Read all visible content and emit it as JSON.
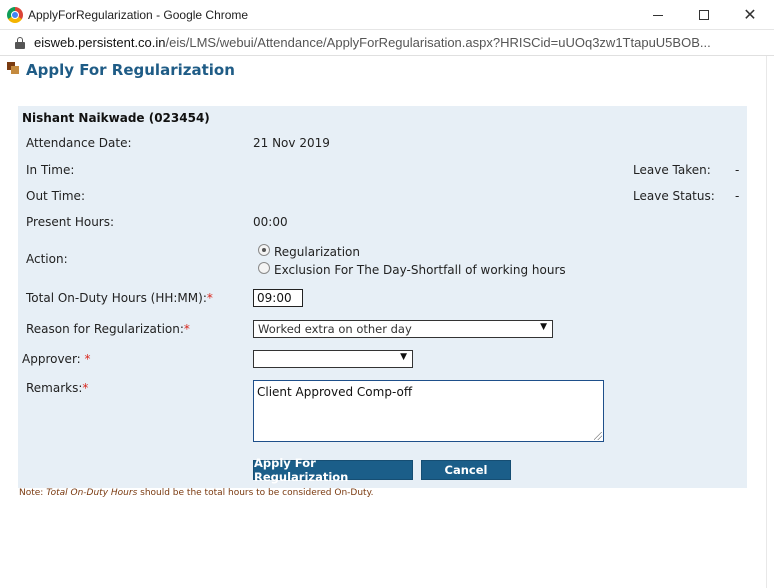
{
  "window": {
    "title": "ApplyForRegularization - Google Chrome",
    "url_prefix": "eisweb.persistent.co.in",
    "url_path": "/eis/LMS/webui/Attendance/ApplyForRegularisation.aspx?HRISCid=uUOq3zw1TtapuU5BOB..."
  },
  "page": {
    "title": "Apply For Regularization"
  },
  "employee": {
    "name": "Nishant Naikwade (023454)"
  },
  "fields": {
    "attendance_date_label": "Attendance Date:",
    "attendance_date_value": "21 Nov 2019",
    "in_time_label": "In Time:",
    "out_time_label": "Out Time:",
    "present_hours_label": "Present Hours:",
    "present_hours_value": "00:00",
    "leave_taken_label": "Leave Taken:",
    "leave_taken_value": "-",
    "leave_status_label": "Leave Status:",
    "leave_status_value": "-",
    "action_label": "Action:",
    "action_option_1": "Regularization",
    "action_option_2": "Exclusion For The Day-Shortfall of working hours",
    "on_duty_label": "Total On-Duty Hours (HH:MM):",
    "on_duty_value": "09:00",
    "reason_label": "Reason for Regularization:",
    "reason_value": "Worked extra on other day",
    "approver_label": "Approver:",
    "approver_value": "",
    "remarks_label": "Remarks:",
    "remarks_value": "Client Approved Comp-off",
    "required_mark": "*"
  },
  "buttons": {
    "apply": "Apply For Regularization",
    "cancel": "Cancel"
  },
  "note": {
    "prefix": "Note: ",
    "emphasis": "Total On-Duty Hours",
    "suffix": " should be the total hours to be considered On-Duty."
  },
  "icons": {
    "dropdown_arrow": "▼",
    "close": "✕"
  }
}
